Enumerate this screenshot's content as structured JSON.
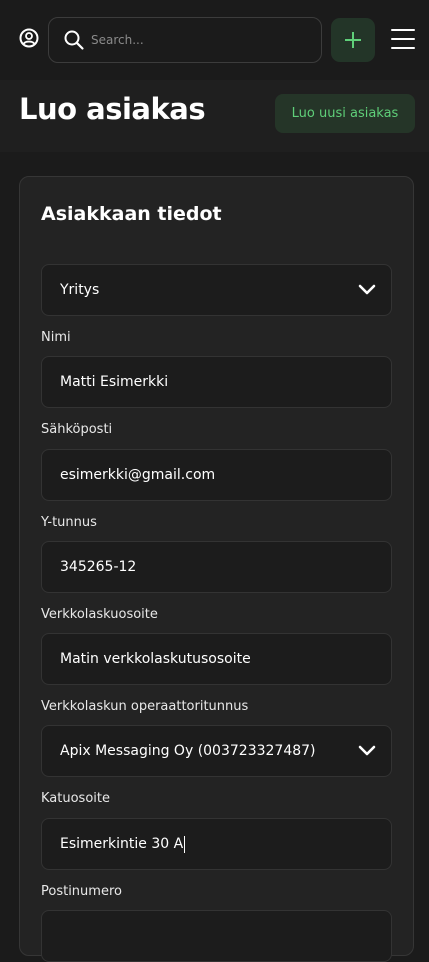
{
  "header": {
    "search_placeholder": "Search...",
    "accent_color": "#5fcf79"
  },
  "page": {
    "title": "Luo asiakas",
    "create_button_label": "Luo uusi asiakas"
  },
  "form": {
    "section_title": "Asiakkaan tiedot",
    "customer_type": "Yritys",
    "fields": {
      "name_label": "Nimi",
      "name_value": "Matti Esimerkki",
      "email_label": "Sähköposti",
      "email_value": "esimerkki@gmail.com",
      "business_id_label": "Y-tunnus",
      "business_id_value": "345265-12",
      "einvoice_address_label": "Verkkolaskuosoite",
      "einvoice_address_value": "Matin verkkolaskutusosoite",
      "operator_label": "Verkkolaskun operaattoritunnus",
      "operator_value": "Apix Messaging Oy (003723327487)",
      "street_label": "Katuosoite",
      "street_value": "Esimerkintie 30 A",
      "postal_label": "Postinumero",
      "postal_value": ""
    }
  }
}
